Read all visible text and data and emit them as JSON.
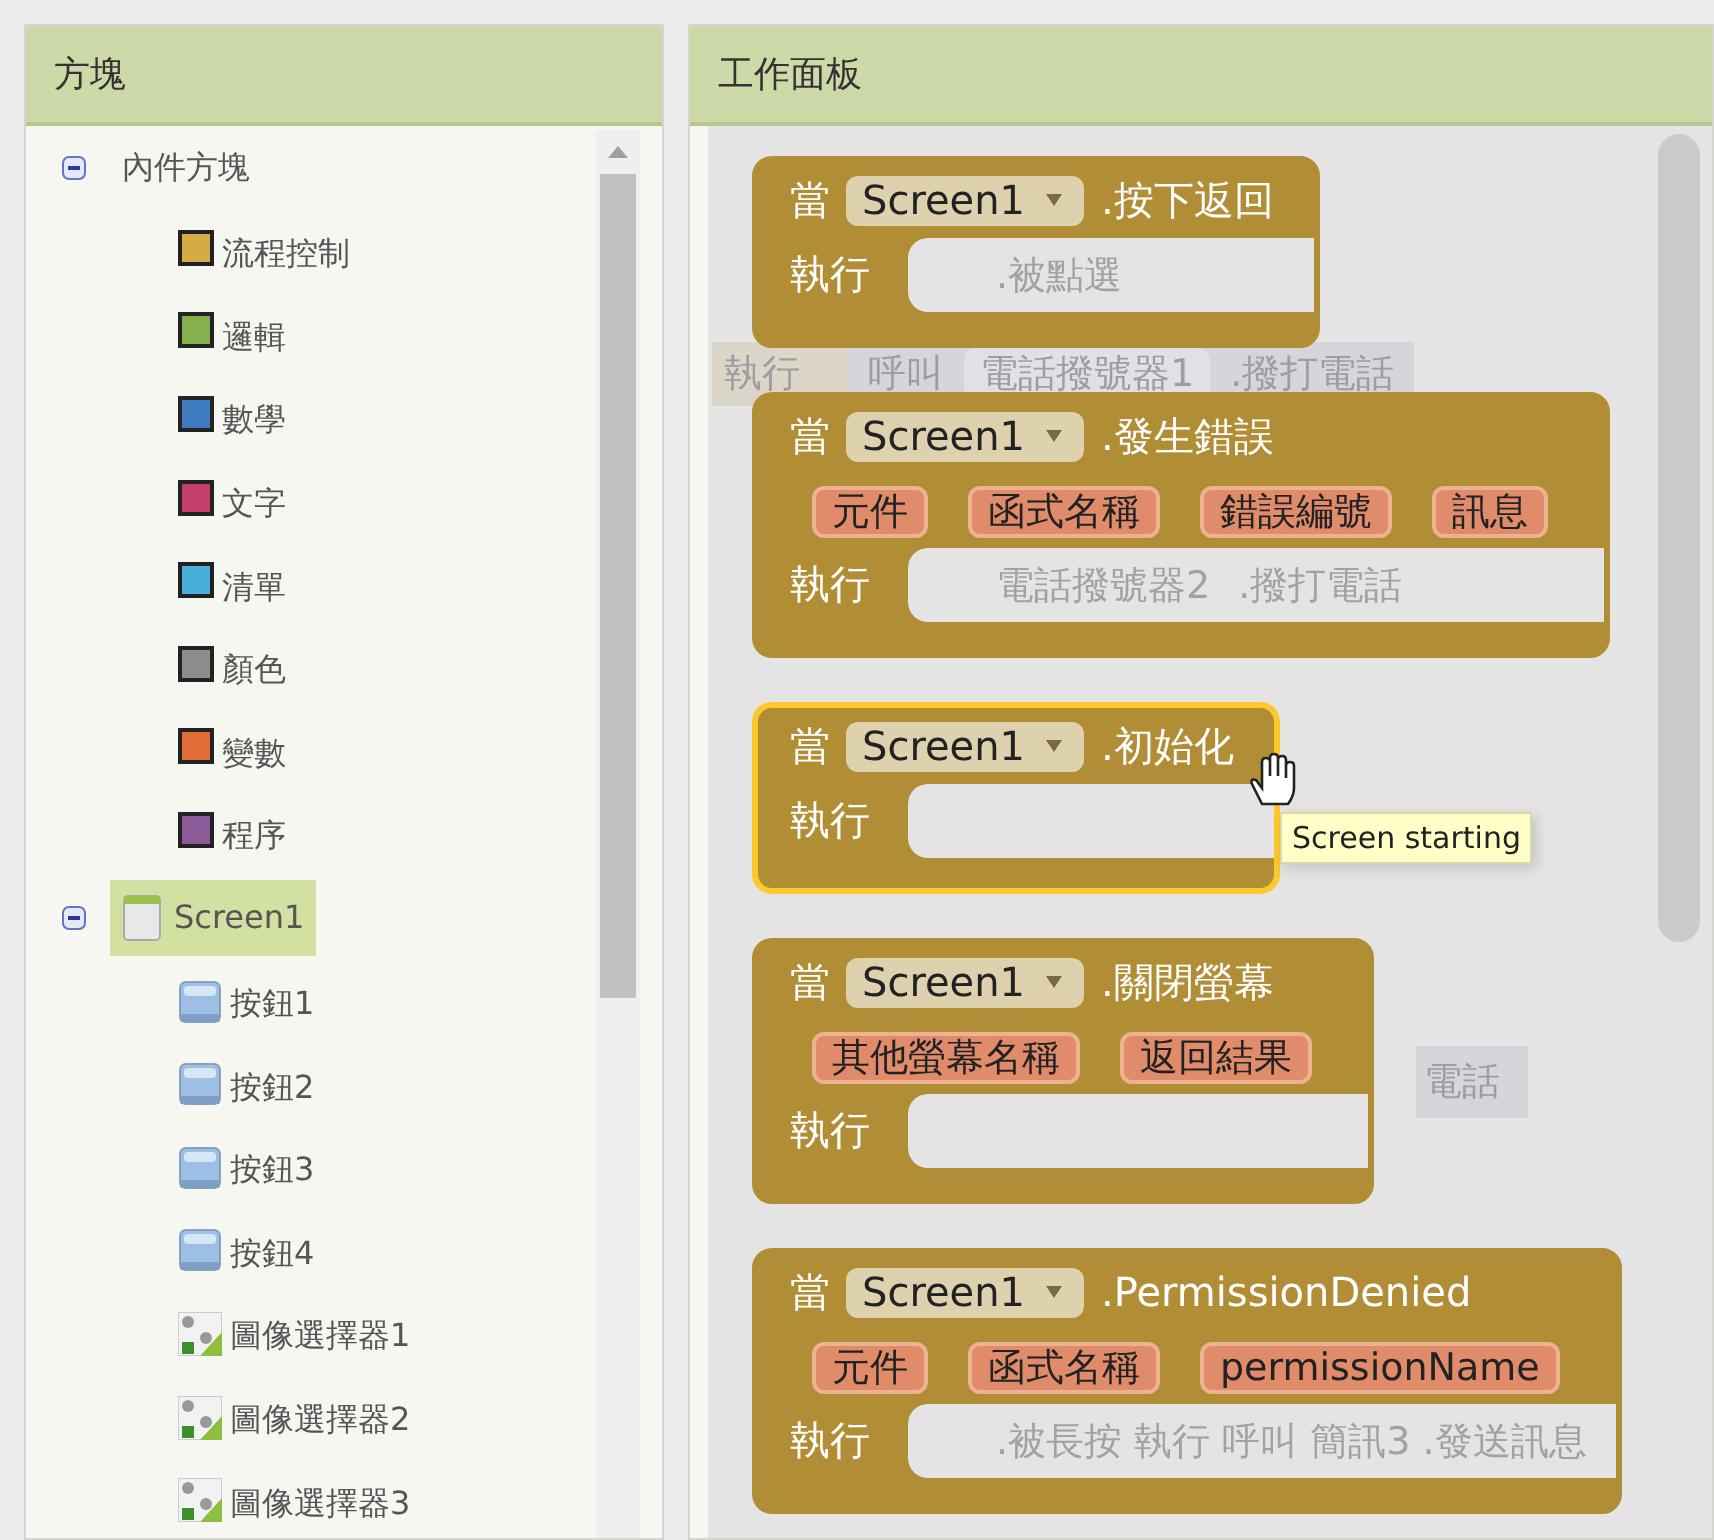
{
  "blocks_panel": {
    "title": "方塊",
    "tree": [
      {
        "label": "內件方塊",
        "kind": "group",
        "expanded": true,
        "selected": false,
        "children": [
          {
            "label": "流程控制",
            "kind": "category",
            "color": "#d4aa46",
            "selected": false
          },
          {
            "label": "邏輯",
            "kind": "category",
            "color": "#84b14c",
            "selected": false
          },
          {
            "label": "數學",
            "kind": "category",
            "color": "#3f7bbf",
            "selected": false
          },
          {
            "label": "文字",
            "kind": "category",
            "color": "#c43e6c",
            "selected": false
          },
          {
            "label": "清單",
            "kind": "category",
            "color": "#4aaedb",
            "selected": false
          },
          {
            "label": "顏色",
            "kind": "category",
            "color": "#8c8c8c",
            "selected": false
          },
          {
            "label": "變數",
            "kind": "category",
            "color": "#e06d33",
            "selected": false
          },
          {
            "label": "程序",
            "kind": "category",
            "color": "#8a5b97",
            "selected": false
          }
        ]
      },
      {
        "label": "Screen1",
        "kind": "screen",
        "expanded": true,
        "selected": true,
        "children": [
          {
            "label": "按鈕1",
            "kind": "button",
            "selected": false
          },
          {
            "label": "按鈕2",
            "kind": "button",
            "selected": false
          },
          {
            "label": "按鈕3",
            "kind": "button",
            "selected": false
          },
          {
            "label": "按鈕4",
            "kind": "button",
            "selected": false
          },
          {
            "label": "圖像選擇器1",
            "kind": "imagepicker",
            "selected": false
          },
          {
            "label": "圖像選擇器2",
            "kind": "imagepicker",
            "selected": false
          },
          {
            "label": "圖像選擇器3",
            "kind": "imagepicker",
            "selected": false
          }
        ]
      }
    ]
  },
  "workspace": {
    "title": "工作面板",
    "background_blocks": [
      {
        "kind": "call",
        "label": "執行",
        "call": "呼叫",
        "component": "電話撥號器1",
        "method": ".撥打電話"
      },
      {
        "kind": "fragment",
        "text": "電話"
      }
    ],
    "blocks": [
      {
        "when": "當",
        "component": "Screen1",
        "event": ".按下返回",
        "do": "執行",
        "slot_ghost": [
          ".被點選"
        ],
        "highlighted": false
      },
      {
        "when": "當",
        "component": "Screen1",
        "event": ".發生錯誤",
        "params": [
          "元件",
          "函式名稱",
          "錯誤編號",
          "訊息"
        ],
        "do": "執行",
        "slot_ghost": [
          "電話撥號器2",
          ".撥打電話"
        ],
        "highlighted": false
      },
      {
        "when": "當",
        "component": "Screen1",
        "event": ".初始化",
        "do": "執行",
        "highlighted": true,
        "tooltip": "Screen starting"
      },
      {
        "when": "當",
        "component": "Screen1",
        "event": ".關閉螢幕",
        "params": [
          "其他螢幕名稱",
          "返回結果"
        ],
        "do": "執行",
        "highlighted": false
      },
      {
        "when": "當",
        "component": "Screen1",
        "event": ".PermissionDenied",
        "params": [
          "元件",
          "函式名稱",
          "permissionName"
        ],
        "do": "執行",
        "slot_ghost": [
          ".被長按 執行 呼叫 簡訊3 .發送訊息"
        ],
        "highlighted": false
      }
    ]
  }
}
